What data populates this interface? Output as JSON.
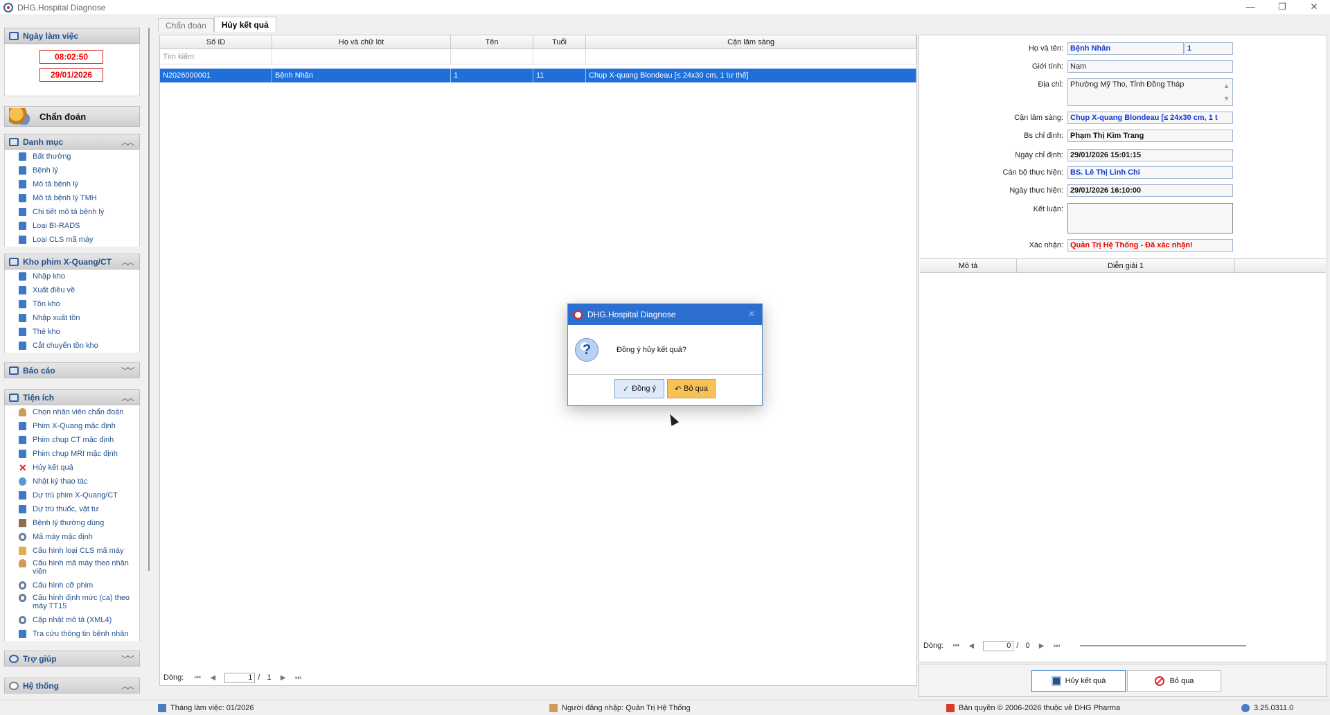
{
  "window": {
    "title": "DHG.Hospital Diagnose",
    "minimize": "—",
    "restore": "❐",
    "close": "✕"
  },
  "sidebar": {
    "work_date": {
      "label": "Ngày làm việc",
      "time": "08:02:50",
      "date": "29/01/2026"
    },
    "diagnose_button": "Chẩn đoán",
    "sections": [
      {
        "label": "Danh mục",
        "items": [
          "Bất thường",
          "Bệnh lý",
          "Mô tả bệnh lý",
          "Mô tả bệnh lý TMH",
          "Chi tiết mô tả bệnh lý",
          "Loại BI-RADS",
          "Loại CLS mã máy"
        ]
      },
      {
        "label": "Kho phim X-Quang/CT",
        "items": [
          "Nhập kho",
          "Xuất điều về",
          "Tồn kho",
          "Nhập xuất tồn",
          "Thẻ kho",
          "Cắt chuyển tồn kho"
        ]
      },
      {
        "label": "Báo cáo",
        "items": []
      },
      {
        "label": "Tiện ích",
        "items": [
          "Chọn nhân viên chẩn đoán",
          "Phim X-Quang mặc định",
          "Phim chụp CT mặc định",
          "Phim chụp MRI mặc định",
          "Hủy kết quả",
          "Nhật ký thao tác",
          "Dự trù phim X-Quang/CT",
          "Dự trù thuốc, vật tư",
          "Bệnh lý thường dùng",
          "Mã máy mặc định",
          "Cấu hình loại CLS mã máy",
          "Cấu hình mã máy theo nhân viên",
          "Cấu hình cỡ phim",
          "Cấu hình định mức (ca) theo máy TT15",
          "Cập nhật mô tả (XML4)",
          "Tra cứu thông tin bệnh nhân"
        ]
      },
      {
        "label": "Trợ giúp",
        "items": []
      },
      {
        "label": "Hệ thống",
        "items": []
      }
    ]
  },
  "tabs": [
    {
      "label": "Chẩn đoán"
    },
    {
      "label": "Hủy kết quả"
    }
  ],
  "grid": {
    "columns": [
      "Số ID",
      "Họ và chữ lót",
      "Tên",
      "Tuổi",
      "Cận lâm sàng"
    ],
    "filter_placeholder": "Tìm kiếm",
    "rows": [
      [
        "N2026000001",
        "Bệnh Nhân",
        "1",
        "11",
        "Chụp X-quang Blondeau [≤ 24x30 cm, 1 tư thế]"
      ]
    ],
    "pager": {
      "label": "Dòng:",
      "current": "1",
      "separator": "/",
      "total": "1"
    }
  },
  "details": {
    "full_name": {
      "label": "Họ và tên:",
      "value": "Bệnh Nhân",
      "value2": "1"
    },
    "gender": {
      "label": "Giới tính:",
      "value": "Nam"
    },
    "address": {
      "label": "Địa chỉ:",
      "value": "Phường Mỹ Tho, Tỉnh Đồng Tháp"
    },
    "clinical": {
      "label": "Cận lâm sàng:",
      "value": "Chụp X-quang Blondeau [≤ 24x30 cm, 1 t"
    },
    "doctor": {
      "label": "Bs chỉ định:",
      "value": "Phạm Thị Kim Trang"
    },
    "order_date": {
      "label": "Ngày chỉ định:",
      "value": "29/01/2026 15:01:15"
    },
    "performer": {
      "label": "Cán bộ thực hiện:",
      "value": "BS. Lê Thị Linh Chi"
    },
    "perform_date": {
      "label": "Ngày thực hiện:",
      "value": "29/01/2026 16:10:00"
    },
    "conclusion": {
      "label": "Kết luận:",
      "value": ""
    },
    "confirm": {
      "label": "Xác nhận:",
      "value": "Quản Trị Hệ Thống - Đã xác nhận!"
    }
  },
  "sub_grid": {
    "columns": [
      "Mô tả",
      "Diễn giải 1"
    ],
    "pager": {
      "label": "Dòng:",
      "current": "0",
      "separator": "/",
      "total": "0"
    }
  },
  "actions": {
    "cancel_result": "Hủy kết quả",
    "skip": "Bỏ qua"
  },
  "statusbar": {
    "month": "Tháng làm việc: 01/2026",
    "user": "Người đăng nhập: Quản Trị Hệ Thống",
    "copyright": "Bản quyền © 2006-2026 thuộc về DHG Pharma",
    "version": "3.25.0311.0"
  },
  "dialog": {
    "title": "DHG.Hospital Diagnose",
    "message": "Đồng ý hủy kết quả?",
    "ok": "Đồng ý",
    "cancel": "Bỏ qua"
  },
  "colors": {
    "accent": "#2d6fd1",
    "selected_row": "#1e6fd9",
    "alert_red": "#e00000",
    "value_blue": "#1338d6"
  }
}
